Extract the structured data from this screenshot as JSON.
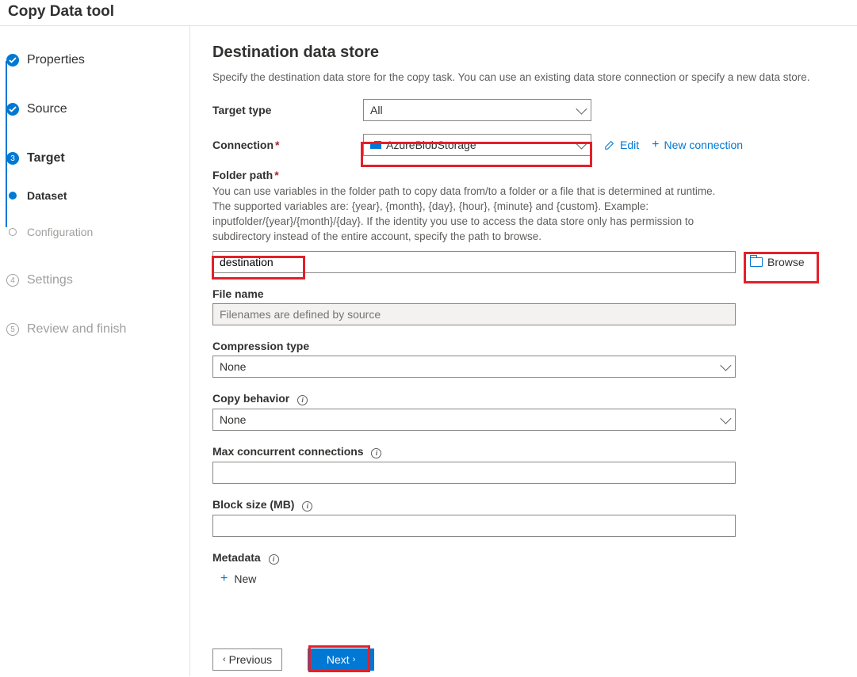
{
  "title": "Copy Data tool",
  "sidebar": {
    "steps": [
      {
        "label": "Properties"
      },
      {
        "label": "Source"
      },
      {
        "label": "Target",
        "number": "3"
      },
      {
        "label": "Dataset"
      },
      {
        "label": "Configuration"
      },
      {
        "label": "Settings",
        "number": "4"
      },
      {
        "label": "Review and finish",
        "number": "5"
      }
    ]
  },
  "page": {
    "heading": "Destination data store",
    "subtitle": "Specify the destination data store for the copy task. You can use an existing data store connection or specify a new data store.",
    "target_type_label": "Target type",
    "target_type_value": "All",
    "connection_label": "Connection",
    "connection_value": "AzureBlobStorage",
    "edit_label": "Edit",
    "new_connection_label": "New connection",
    "folder_path_label": "Folder path",
    "folder_path_help": "You can use variables in the folder path to copy data from/to a folder or a file that is determined at runtime. The supported variables are: {year}, {month}, {day}, {hour}, {minute} and {custom}. Example: inputfolder/{year}/{month}/{day}. If the identity you use to access the data store only has permission to subdirectory instead of the entire account, specify the path to browse.",
    "folder_path_value": "destination",
    "browse_label": "Browse",
    "file_name_label": "File name",
    "file_name_placeholder": "Filenames are defined by source",
    "compression_label": "Compression type",
    "compression_value": "None",
    "copy_behavior_label": "Copy behavior",
    "copy_behavior_value": "None",
    "max_conn_label": "Max concurrent connections",
    "block_size_label": "Block size (MB)",
    "metadata_label": "Metadata",
    "metadata_new": "New"
  },
  "footer": {
    "previous": "Previous",
    "next": "Next"
  }
}
